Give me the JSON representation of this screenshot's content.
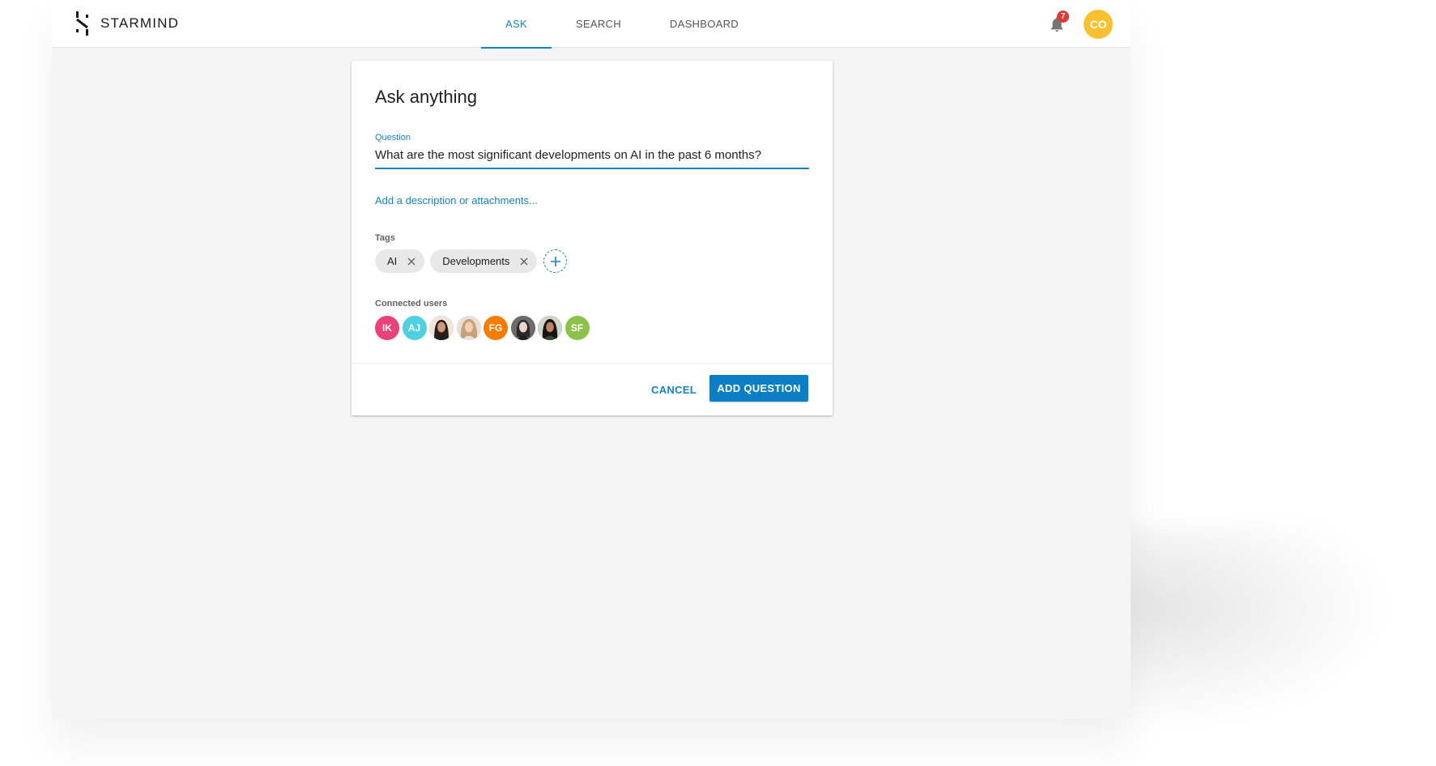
{
  "header": {
    "brand": "STARMIND",
    "nav": [
      {
        "label": "ASK",
        "active": true
      },
      {
        "label": "SEARCH",
        "active": false
      },
      {
        "label": "DASHBOARD",
        "active": false
      }
    ],
    "notification_count": "7",
    "user_initials": "CO"
  },
  "dialog": {
    "title": "Ask anything",
    "question_label": "Question",
    "question_value": "What are the most significant developments on AI in the past 6 months?",
    "description_link": "Add a description or attachments...",
    "tags_label": "Tags",
    "tags": [
      "AI",
      "Developments"
    ],
    "connected_users_label": "Connected users",
    "connected_users": [
      {
        "initials": "IK",
        "color": "#ec407a"
      },
      {
        "initials": "AJ",
        "color": "#4dd0e1"
      },
      {
        "initials": "",
        "color": "#8d6e63"
      },
      {
        "initials": "",
        "color": "#d7ccc8"
      },
      {
        "initials": "FG",
        "color": "#f57c00"
      },
      {
        "initials": "",
        "color": "#757575"
      },
      {
        "initials": "",
        "color": "#5d4037"
      },
      {
        "initials": "SF",
        "color": "#8bc34a"
      }
    ],
    "cancel_label": "CANCEL",
    "submit_label": "ADD QUESTION"
  },
  "colors": {
    "accent": "#1484c5",
    "primary_button": "#0b7fc6",
    "badge": "#e53935",
    "user_avatar": "#fbc02d"
  }
}
